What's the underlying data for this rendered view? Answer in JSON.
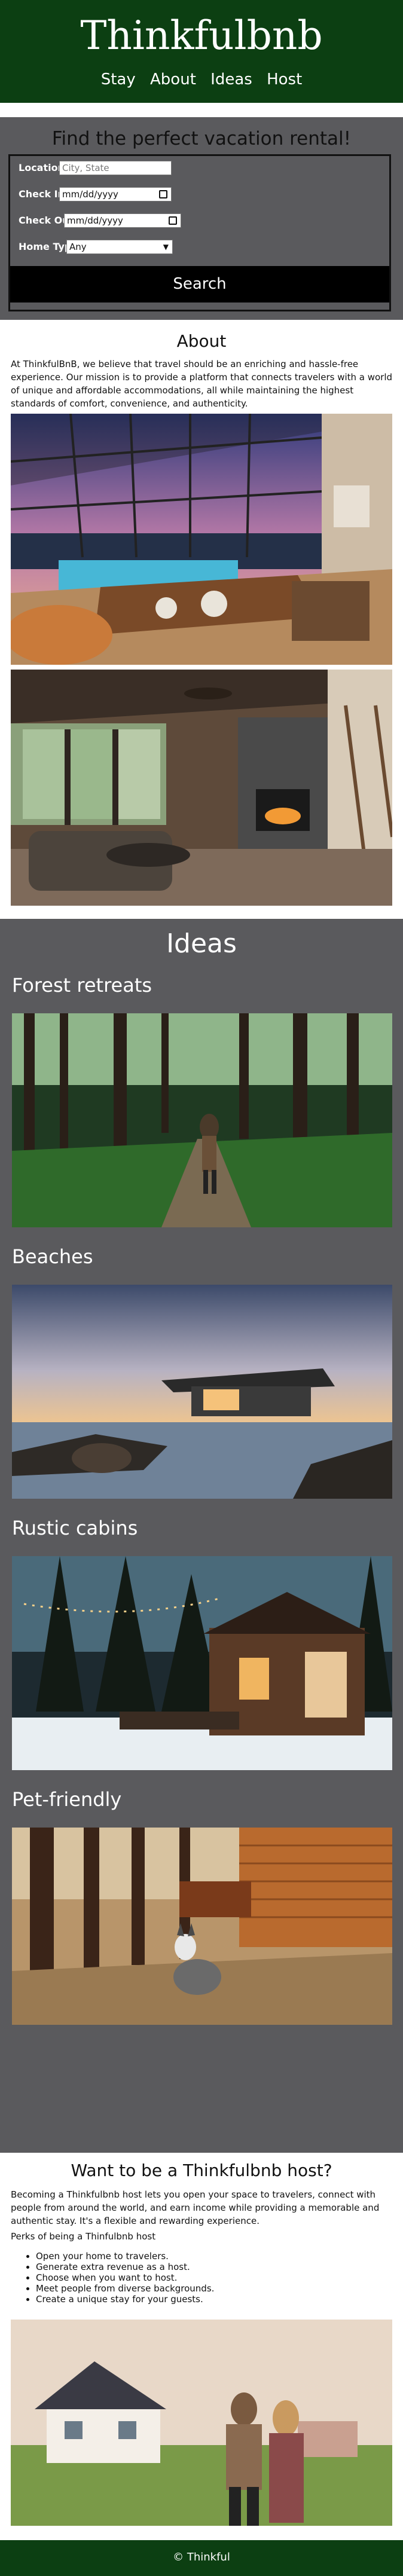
{
  "site": {
    "title": "Thinkfulbnb"
  },
  "nav": {
    "items": [
      "Stay",
      "About",
      "Ideas",
      "Host"
    ]
  },
  "search": {
    "title": "Find the perfect vacation rental!",
    "location_label": "Location:",
    "location_placeholder": "City, State",
    "checkin_label": "Check In:",
    "checkin_value": "mm/dd/yyyy",
    "checkout_label": "Check Out:",
    "checkout_value": "mm/dd/yyyy",
    "home_type_label": "Home Type:",
    "home_type_value": "Any",
    "button": "Search"
  },
  "about": {
    "title": "About",
    "paragraph": "At ThinkfulBnB, we believe that travel should be an enriching and hassle-free experience. Our mission is to provide a platform that connects travelers with a world of unique and affordable accommodations, all while maintaining the highest standards of comfort, convenience, and authenticity."
  },
  "ideas": {
    "title": "Ideas",
    "items": [
      "Forest retreats",
      "Beaches",
      "Rustic cabins",
      "Pet-friendly"
    ]
  },
  "host": {
    "title": "Want to be a Thinkfulbnb host?",
    "paragraph1": "Becoming a Thinkfulbnb host lets you open your space to travelers, connect with people from around the world, and earn income while providing a memorable and authentic stay. It's a flexible and rewarding experience.",
    "perks_title": "Perks of being a Thinfulbnb host",
    "perks": [
      "Open your home to travelers.",
      "Generate extra revenue as a host.",
      "Choose when you want to host.",
      "Meet people from diverse backgrounds.",
      "Create a unique stay for your guests."
    ]
  },
  "footer": {
    "text": "© Thinkful"
  },
  "colors": {
    "brand_green": "#0c3f12",
    "section_gray": "#5a5a5d"
  }
}
